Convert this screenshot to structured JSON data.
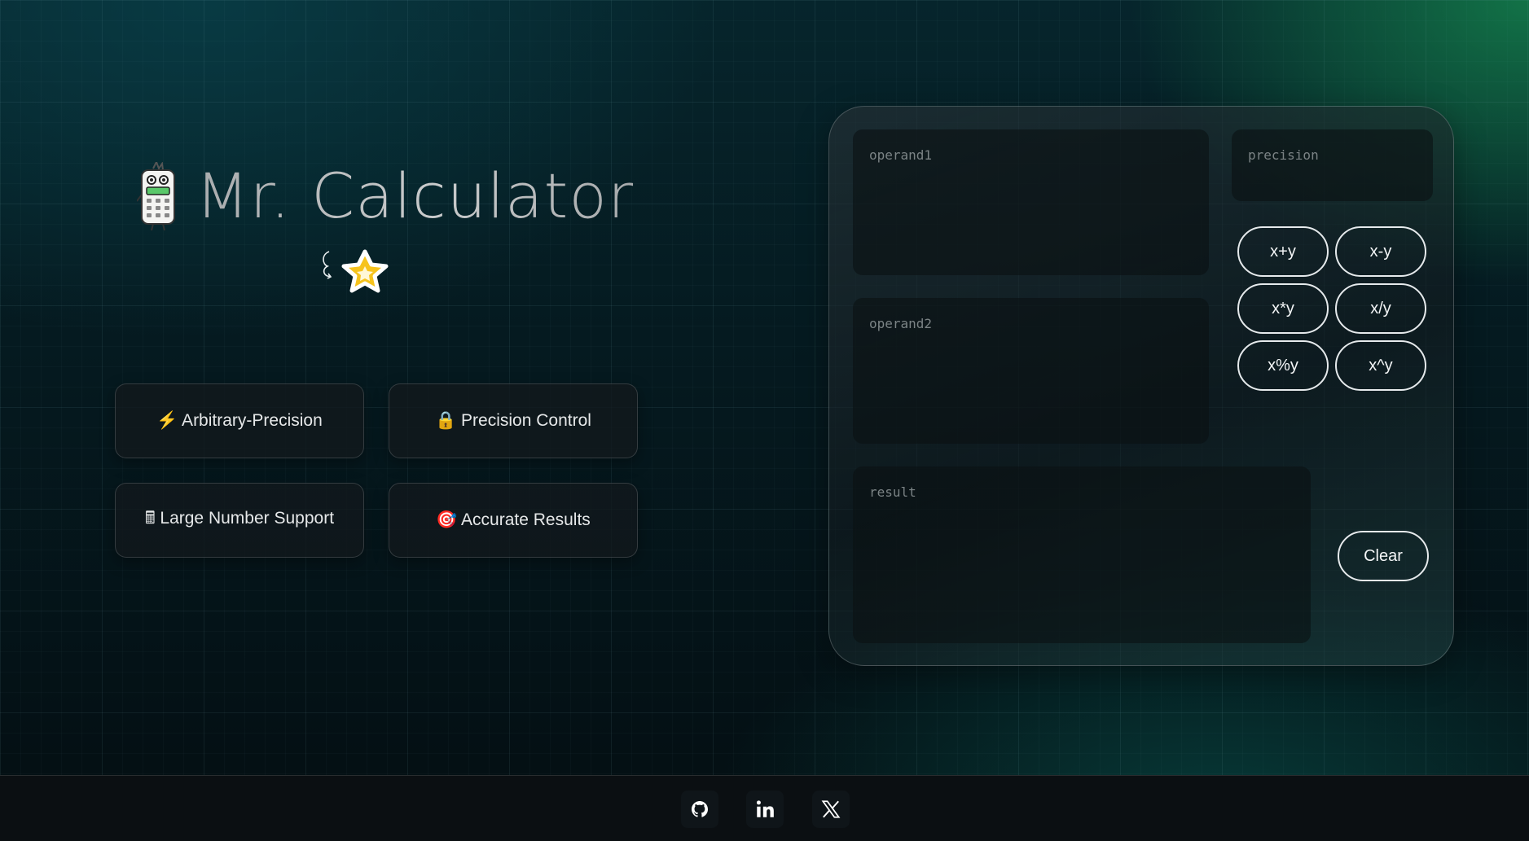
{
  "app": {
    "title": "Mr. Calculator"
  },
  "hero": {
    "title": "Mr. Calculator",
    "mascot_icon": "calculator-mascot-icon",
    "star_icon": "star-icon"
  },
  "features": [
    {
      "icon": "⚡",
      "label": "Arbitrary-Precision",
      "text": "⚡ Arbitrary-Precision"
    },
    {
      "icon": "🔒",
      "label": "Precision Control",
      "text": "🔒 Precision Control"
    },
    {
      "icon": "🖩",
      "label": "Large Number Support",
      "text": "🖩 Large Number Support"
    },
    {
      "icon": "🎯",
      "label": "Accurate Results",
      "text": "🎯 Accurate Results"
    }
  ],
  "calculator": {
    "operand1": {
      "placeholder": "operand1",
      "value": ""
    },
    "operand2": {
      "placeholder": "operand2",
      "value": ""
    },
    "precision": {
      "placeholder": "precision",
      "value": ""
    },
    "result": {
      "placeholder": "result",
      "value": ""
    },
    "operations": [
      "x+y",
      "x-y",
      "x*y",
      "x/y",
      "x%y",
      "x^y"
    ],
    "clear_label": "Clear"
  },
  "footer": {
    "links": [
      {
        "icon": "github-icon"
      },
      {
        "icon": "linkedin-icon"
      },
      {
        "icon": "x-twitter-icon"
      }
    ]
  },
  "colors": {
    "background": "#051a20",
    "accent_green": "#168c50",
    "star_yellow": "#f6c31d",
    "button_border": "#e6eaec"
  }
}
